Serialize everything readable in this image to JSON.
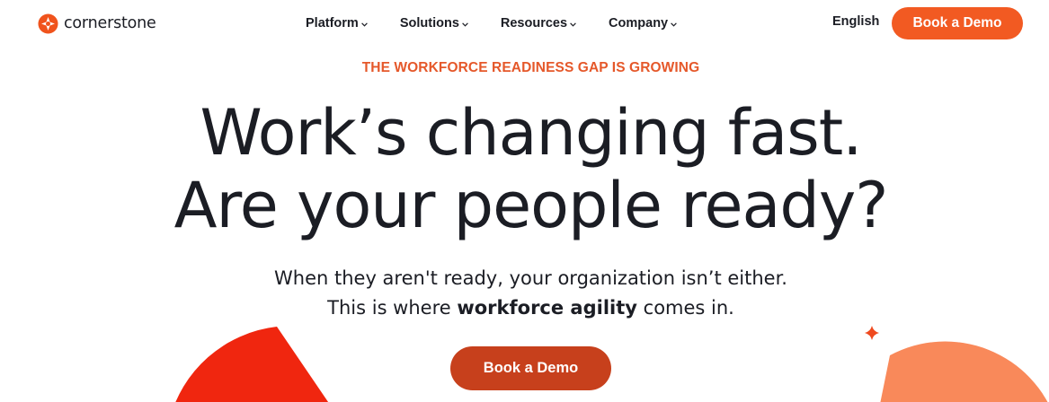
{
  "brand": {
    "name": "cornerstone"
  },
  "nav": {
    "items": [
      {
        "label": "Platform"
      },
      {
        "label": "Solutions"
      },
      {
        "label": "Resources"
      },
      {
        "label": "Company"
      }
    ],
    "language": "English",
    "cta": "Book a Demo"
  },
  "hero": {
    "eyebrow": "THE WORKFORCE READINESS GAP IS GROWING",
    "headline_line1": "Work’s changing fast.",
    "headline_line2": "Are your people ready?",
    "sub_line1": "When they aren't ready, your organization isn’t either.",
    "sub_line2_pre": "This is where ",
    "sub_line2_bold": "workforce agility",
    "sub_line2_post": " comes in.",
    "cta": "Book a Demo"
  },
  "colors": {
    "accent": "#f25a22",
    "cta_dark": "#c7401c",
    "eyebrow": "#e5582a",
    "text": "#1b1d24"
  },
  "icons": {
    "logo": "cornerstone-logo-icon",
    "chevron": "chevron-down-icon",
    "sparkle": "sparkle-icon"
  }
}
